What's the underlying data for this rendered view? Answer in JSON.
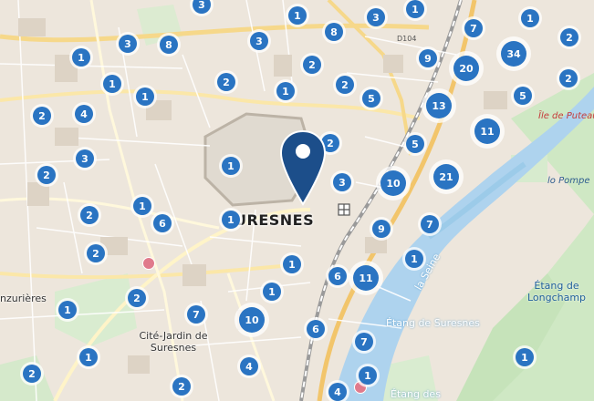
{
  "map": {
    "city_label": "SURESNES",
    "places": {
      "cite_jardin": "Cité-Jardin de Suresnes",
      "left_partial": "nzurières",
      "ile_puteaux": "Île de Puteaux",
      "pompe": "lo Pompe",
      "etang_longchamp": "Étang de Longchamp",
      "etang_suresnes": "Étang de Suresnes",
      "etang_des": "Étang des",
      "la_seine": "la Seine",
      "road_d104": "D104"
    },
    "pin": {
      "icon": "map-pin-icon",
      "color": "#1c4e8a"
    },
    "station_icon": "train-station-icon",
    "cluster_color": "#2a74c2",
    "clusters": [
      {
        "count": "3"
      },
      {
        "count": "1"
      },
      {
        "count": "3"
      },
      {
        "count": "1"
      },
      {
        "count": "1"
      },
      {
        "count": "2"
      },
      {
        "count": "7"
      },
      {
        "count": "3"
      },
      {
        "count": "8"
      },
      {
        "count": "3"
      },
      {
        "count": "8"
      },
      {
        "count": "9"
      },
      {
        "count": "1"
      },
      {
        "count": "2"
      },
      {
        "count": "2"
      },
      {
        "count": "20"
      },
      {
        "count": "34"
      },
      {
        "count": "1"
      },
      {
        "count": "2"
      },
      {
        "count": "2"
      },
      {
        "count": "2"
      },
      {
        "count": "1"
      },
      {
        "count": "5"
      },
      {
        "count": "1"
      },
      {
        "count": "5"
      },
      {
        "count": "2"
      },
      {
        "count": "4"
      },
      {
        "count": "13"
      },
      {
        "count": "11"
      },
      {
        "count": "5"
      },
      {
        "count": "3"
      },
      {
        "count": "2"
      },
      {
        "count": "1"
      },
      {
        "count": "3"
      },
      {
        "count": "10"
      },
      {
        "count": "21"
      },
      {
        "count": "1"
      },
      {
        "count": "2"
      },
      {
        "count": "6"
      },
      {
        "count": "1"
      },
      {
        "count": "9"
      },
      {
        "count": "7"
      },
      {
        "count": "2"
      },
      {
        "count": "1"
      },
      {
        "count": "6"
      },
      {
        "count": "11"
      },
      {
        "count": "1"
      },
      {
        "count": "1"
      },
      {
        "count": "2"
      },
      {
        "count": "7"
      },
      {
        "count": "10"
      },
      {
        "count": "6"
      },
      {
        "count": "7"
      },
      {
        "count": "1"
      },
      {
        "count": "1"
      },
      {
        "count": "4"
      },
      {
        "count": "2"
      },
      {
        "count": "2"
      },
      {
        "count": "4"
      },
      {
        "count": "1"
      },
      {
        "count": "1"
      }
    ]
  }
}
